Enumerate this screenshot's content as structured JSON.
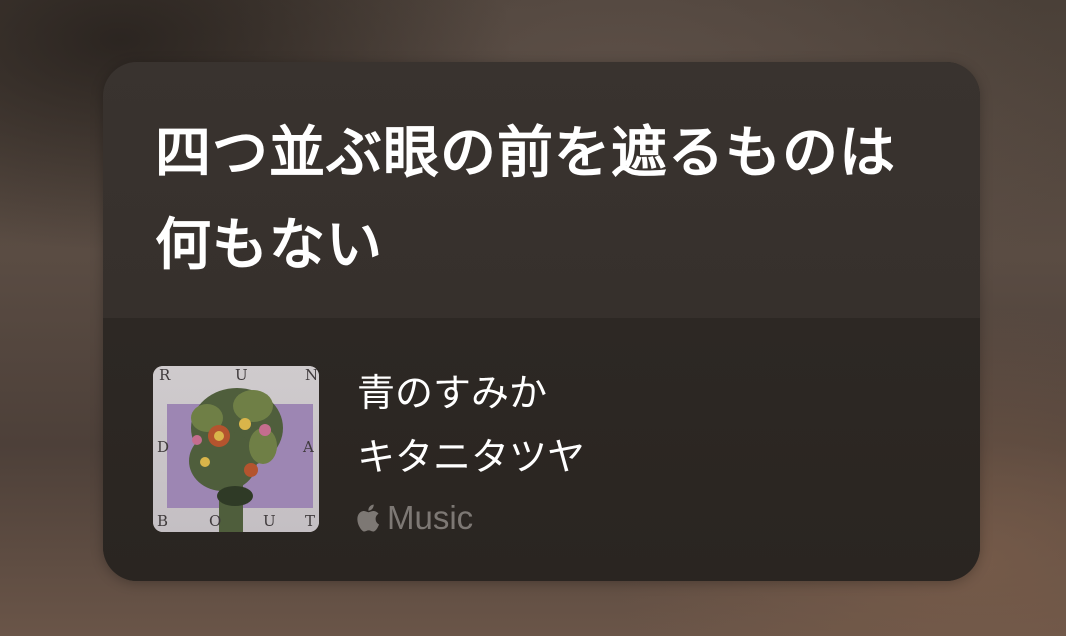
{
  "siri_card": {
    "lyric": "四つ並ぶ眼の前を遮るものは何もない",
    "song": {
      "title": "青のすみか",
      "artist": "キタニタツヤ",
      "service": "Music",
      "service_icon": "apple-logo-icon",
      "artwork_icon": "album-artwork-image",
      "artwork_letters": [
        "R",
        "U",
        "N",
        "D",
        "A",
        "B",
        "O",
        "U",
        "T"
      ]
    },
    "colors": {
      "card_top": "#39332f",
      "card_bottom": "#2a2521",
      "text_primary": "#ffffff",
      "text_secondary": "#7d7874",
      "artwork_accent": "#9d86b3"
    }
  }
}
